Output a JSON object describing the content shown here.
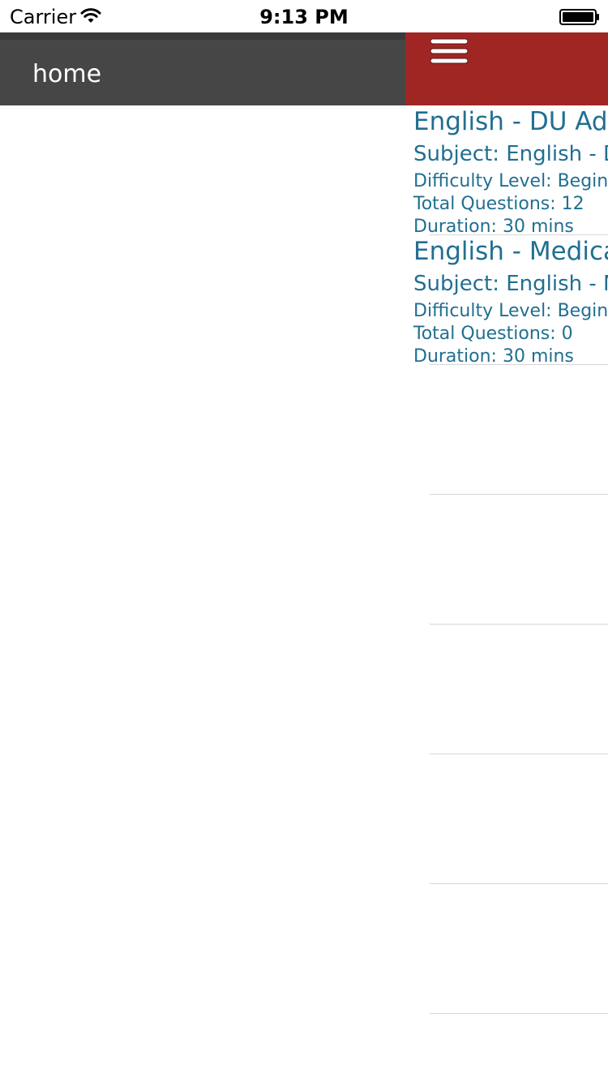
{
  "status_bar": {
    "carrier": "Carrier",
    "time": "9:13 PM",
    "wifi_icon": "wifi-icon",
    "battery_icon": "battery-full-icon"
  },
  "drawer": {
    "home_label": "home",
    "header_color": "#464646"
  },
  "main": {
    "header_color": "#a02624",
    "menu_icon": "hamburger-menu-icon",
    "text_color": "#216f91",
    "quizzes": [
      {
        "title": "English - DU Adr",
        "subject": "Subject: English - D",
        "difficulty": "Difficulty Level: Beginn",
        "total_questions": "Total Questions: 12",
        "duration": "Duration: 30 mins"
      },
      {
        "title": "English - Medica",
        "subject": "Subject: English - M",
        "difficulty": "Difficulty Level: Beginn",
        "total_questions": "Total Questions: 0",
        "duration": "Duration: 30 mins"
      }
    ]
  }
}
